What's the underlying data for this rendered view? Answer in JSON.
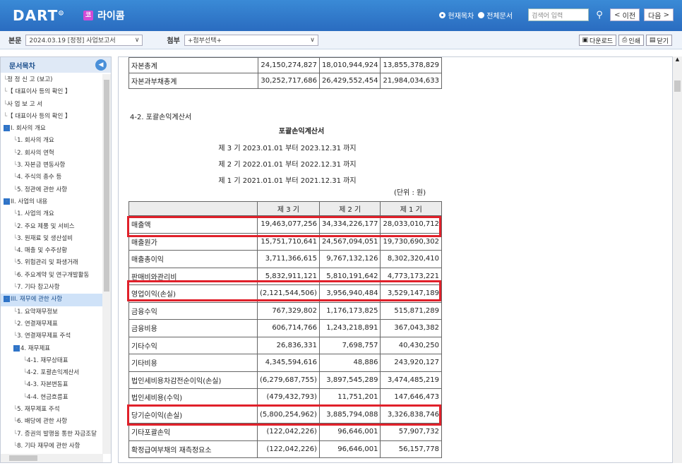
{
  "header": {
    "logo": "DART",
    "company_icon": "코",
    "company": "라이콤",
    "radio_current": "현재목차",
    "radio_all": "전체문서",
    "search_placeholder": "검색어 입력",
    "prev": "이전",
    "next": "다음"
  },
  "bar2": {
    "doc_label": "본문",
    "doc_value": "2024.03.19 [정정] 사업보고서",
    "attach_label": "첨부",
    "attach_value": "+첨부선택+",
    "download": "다운로드",
    "print": "인쇄",
    "close": "닫기"
  },
  "sidebar": {
    "title": "문서목차",
    "items": [
      {
        "text": "정 정 신 고 (보고)",
        "indent": 0,
        "mark": ""
      },
      {
        "text": "【 대표이사 등의 확인 】",
        "indent": 0,
        "mark": ""
      },
      {
        "text": "사 업 보 고 서",
        "indent": 0,
        "mark": ""
      },
      {
        "text": "【 대표이사 등의 확인 】",
        "indent": 0,
        "mark": ""
      },
      {
        "text": "I. 회사의 개요",
        "indent": 0,
        "mark": "-"
      },
      {
        "text": "1. 회사의 개요",
        "indent": 1,
        "mark": ""
      },
      {
        "text": "2. 회사의 연혁",
        "indent": 1,
        "mark": ""
      },
      {
        "text": "3. 자본금 변동사항",
        "indent": 1,
        "mark": ""
      },
      {
        "text": "4. 주식의 총수 등",
        "indent": 1,
        "mark": ""
      },
      {
        "text": "5. 정관에 관한 사항",
        "indent": 1,
        "mark": ""
      },
      {
        "text": "II. 사업의 내용",
        "indent": 0,
        "mark": "-"
      },
      {
        "text": "1. 사업의 개요",
        "indent": 1,
        "mark": ""
      },
      {
        "text": "2. 주요 제품 및 서비스",
        "indent": 1,
        "mark": ""
      },
      {
        "text": "3. 원재료 및 생산설비",
        "indent": 1,
        "mark": ""
      },
      {
        "text": "4. 매출 및 수주상황",
        "indent": 1,
        "mark": ""
      },
      {
        "text": "5. 위험관리 및 파생거래",
        "indent": 1,
        "mark": ""
      },
      {
        "text": "6. 주요계약 및 연구개발활동",
        "indent": 1,
        "mark": ""
      },
      {
        "text": "7. 기타 참고사항",
        "indent": 1,
        "mark": ""
      },
      {
        "text": "III. 재무에 관한 사항",
        "indent": 0,
        "mark": "-",
        "hl": true
      },
      {
        "text": "1. 요약재무정보",
        "indent": 1,
        "mark": ""
      },
      {
        "text": "2. 연결재무제표",
        "indent": 1,
        "mark": ""
      },
      {
        "text": "3. 연결재무제표 주석",
        "indent": 1,
        "mark": ""
      },
      {
        "text": "4. 재무제표",
        "indent": 1,
        "mark": "-"
      },
      {
        "text": "4-1. 재무상태표",
        "indent": 2,
        "mark": ""
      },
      {
        "text": "4-2. 포괄손익계산서",
        "indent": 2,
        "mark": ""
      },
      {
        "text": "4-3. 자본변동표",
        "indent": 2,
        "mark": ""
      },
      {
        "text": "4-4. 현금흐름표",
        "indent": 2,
        "mark": ""
      },
      {
        "text": "5. 재무제표 주석",
        "indent": 1,
        "mark": ""
      },
      {
        "text": "6. 배당에 관한 사항",
        "indent": 1,
        "mark": ""
      },
      {
        "text": "7. 증권의 발행을 통한 자금조달",
        "indent": 1,
        "mark": ""
      },
      {
        "text": "8. 기타 재무에 관한 사항",
        "indent": 1,
        "mark": ""
      }
    ]
  },
  "main": {
    "top_table": [
      {
        "label": "자본총계",
        "v3": "24,150,274,827",
        "v2": "18,010,944,924",
        "v1": "13,855,378,829"
      },
      {
        "label": "자본과부채총계",
        "v3": "30,252,717,686",
        "v2": "26,429,552,454",
        "v1": "21,984,034,633"
      }
    ],
    "section": "4-2. 포괄손익계산서",
    "title": "포괄손익계산서",
    "periods": [
      "제 3 기 2023.01.01 부터 2023.12.31 까지",
      "제 2 기 2022.01.01 부터 2022.12.31 까지",
      "제 1 기 2021.01.01 부터 2021.12.31 까지"
    ],
    "unit": "(단위 : 원)",
    "headers": [
      "",
      "제 3 기",
      "제 2 기",
      "제 1 기"
    ],
    "rows": [
      {
        "label": "매출액",
        "v3": "19,463,077,256",
        "v2": "34,334,226,177",
        "v1": "28,033,010,712",
        "hl": true
      },
      {
        "label": "매출원가",
        "v3": "15,751,710,641",
        "v2": "24,567,094,051",
        "v1": "19,730,690,302"
      },
      {
        "label": "매출총이익",
        "v3": "3,711,366,615",
        "v2": "9,767,132,126",
        "v1": "8,302,320,410"
      },
      {
        "label": "판매비와관리비",
        "v3": "5,832,911,121",
        "v2": "5,810,191,642",
        "v1": "4,773,173,221"
      },
      {
        "label": "영업이익(손실)",
        "v3": "(2,121,544,506)",
        "v2": "3,956,940,484",
        "v1": "3,529,147,189",
        "hl": true
      },
      {
        "label": "금융수익",
        "v3": "767,329,802",
        "v2": "1,176,173,825",
        "v1": "515,871,289"
      },
      {
        "label": "금융비용",
        "v3": "606,714,766",
        "v2": "1,243,218,891",
        "v1": "367,043,382"
      },
      {
        "label": "기타수익",
        "v3": "26,836,331",
        "v2": "7,698,757",
        "v1": "40,430,250"
      },
      {
        "label": "기타비용",
        "v3": "4,345,594,616",
        "v2": "48,886",
        "v1": "243,920,127"
      },
      {
        "label": "법인세비용차감전순이익(손실)",
        "v3": "(6,279,687,755)",
        "v2": "3,897,545,289",
        "v1": "3,474,485,219"
      },
      {
        "label": "법인세비용(수익)",
        "v3": "(479,432,793)",
        "v2": "11,751,201",
        "v1": "147,646,473"
      },
      {
        "label": "당기순이익(손실)",
        "v3": "(5,800,254,962)",
        "v2": "3,885,794,088",
        "v1": "3,326,838,746",
        "hl": true
      },
      {
        "label": "기타포괄손익",
        "v3": "(122,042,226)",
        "v2": "96,646,001",
        "v1": "57,907,732"
      },
      {
        "label": "확정급여부채의 재측정요소",
        "v3": "(122,042,226)",
        "v2": "96,646,001",
        "v1": "56,157,778"
      }
    ]
  }
}
